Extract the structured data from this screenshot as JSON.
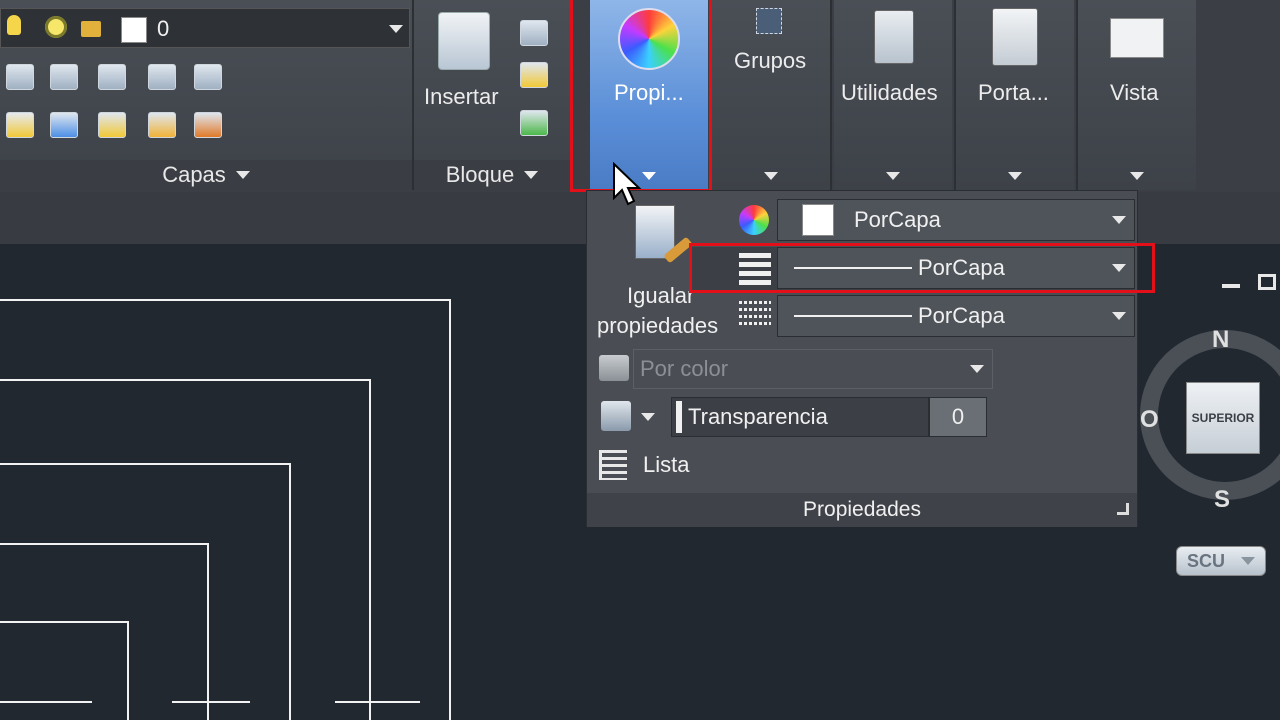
{
  "ribbon": {
    "layer_name": "0",
    "capas_label": "Capas",
    "bloque_label": "Bloque",
    "insertar_label": "Insertar",
    "propiedades_btn_label": "Propi...",
    "grupos_label": "Grupos",
    "utilidades_label": "Utilidades",
    "portapapeles_label": "Porta...",
    "vista_label": "Vista"
  },
  "properties_panel": {
    "igualar_line1": "Igualar",
    "igualar_line2": "propiedades",
    "color_value": "PorCapa",
    "lineweight_value": "PorCapa",
    "linetype_value": "PorCapa",
    "plotstyle_value": "Por color",
    "transparency_label": "Transparencia",
    "transparency_value": "0",
    "lista_label": "Lista",
    "footer_label": "Propiedades"
  },
  "viewcube": {
    "north": "N",
    "south": "S",
    "west": "O",
    "face": "SUPERIOR",
    "ucs": "SCU"
  },
  "colors": {
    "ribbon_bg": "#3b3f45",
    "canvas_bg": "#212830",
    "highlight_blue": "#6f9fe0",
    "highlight_red": "#e3101a"
  }
}
